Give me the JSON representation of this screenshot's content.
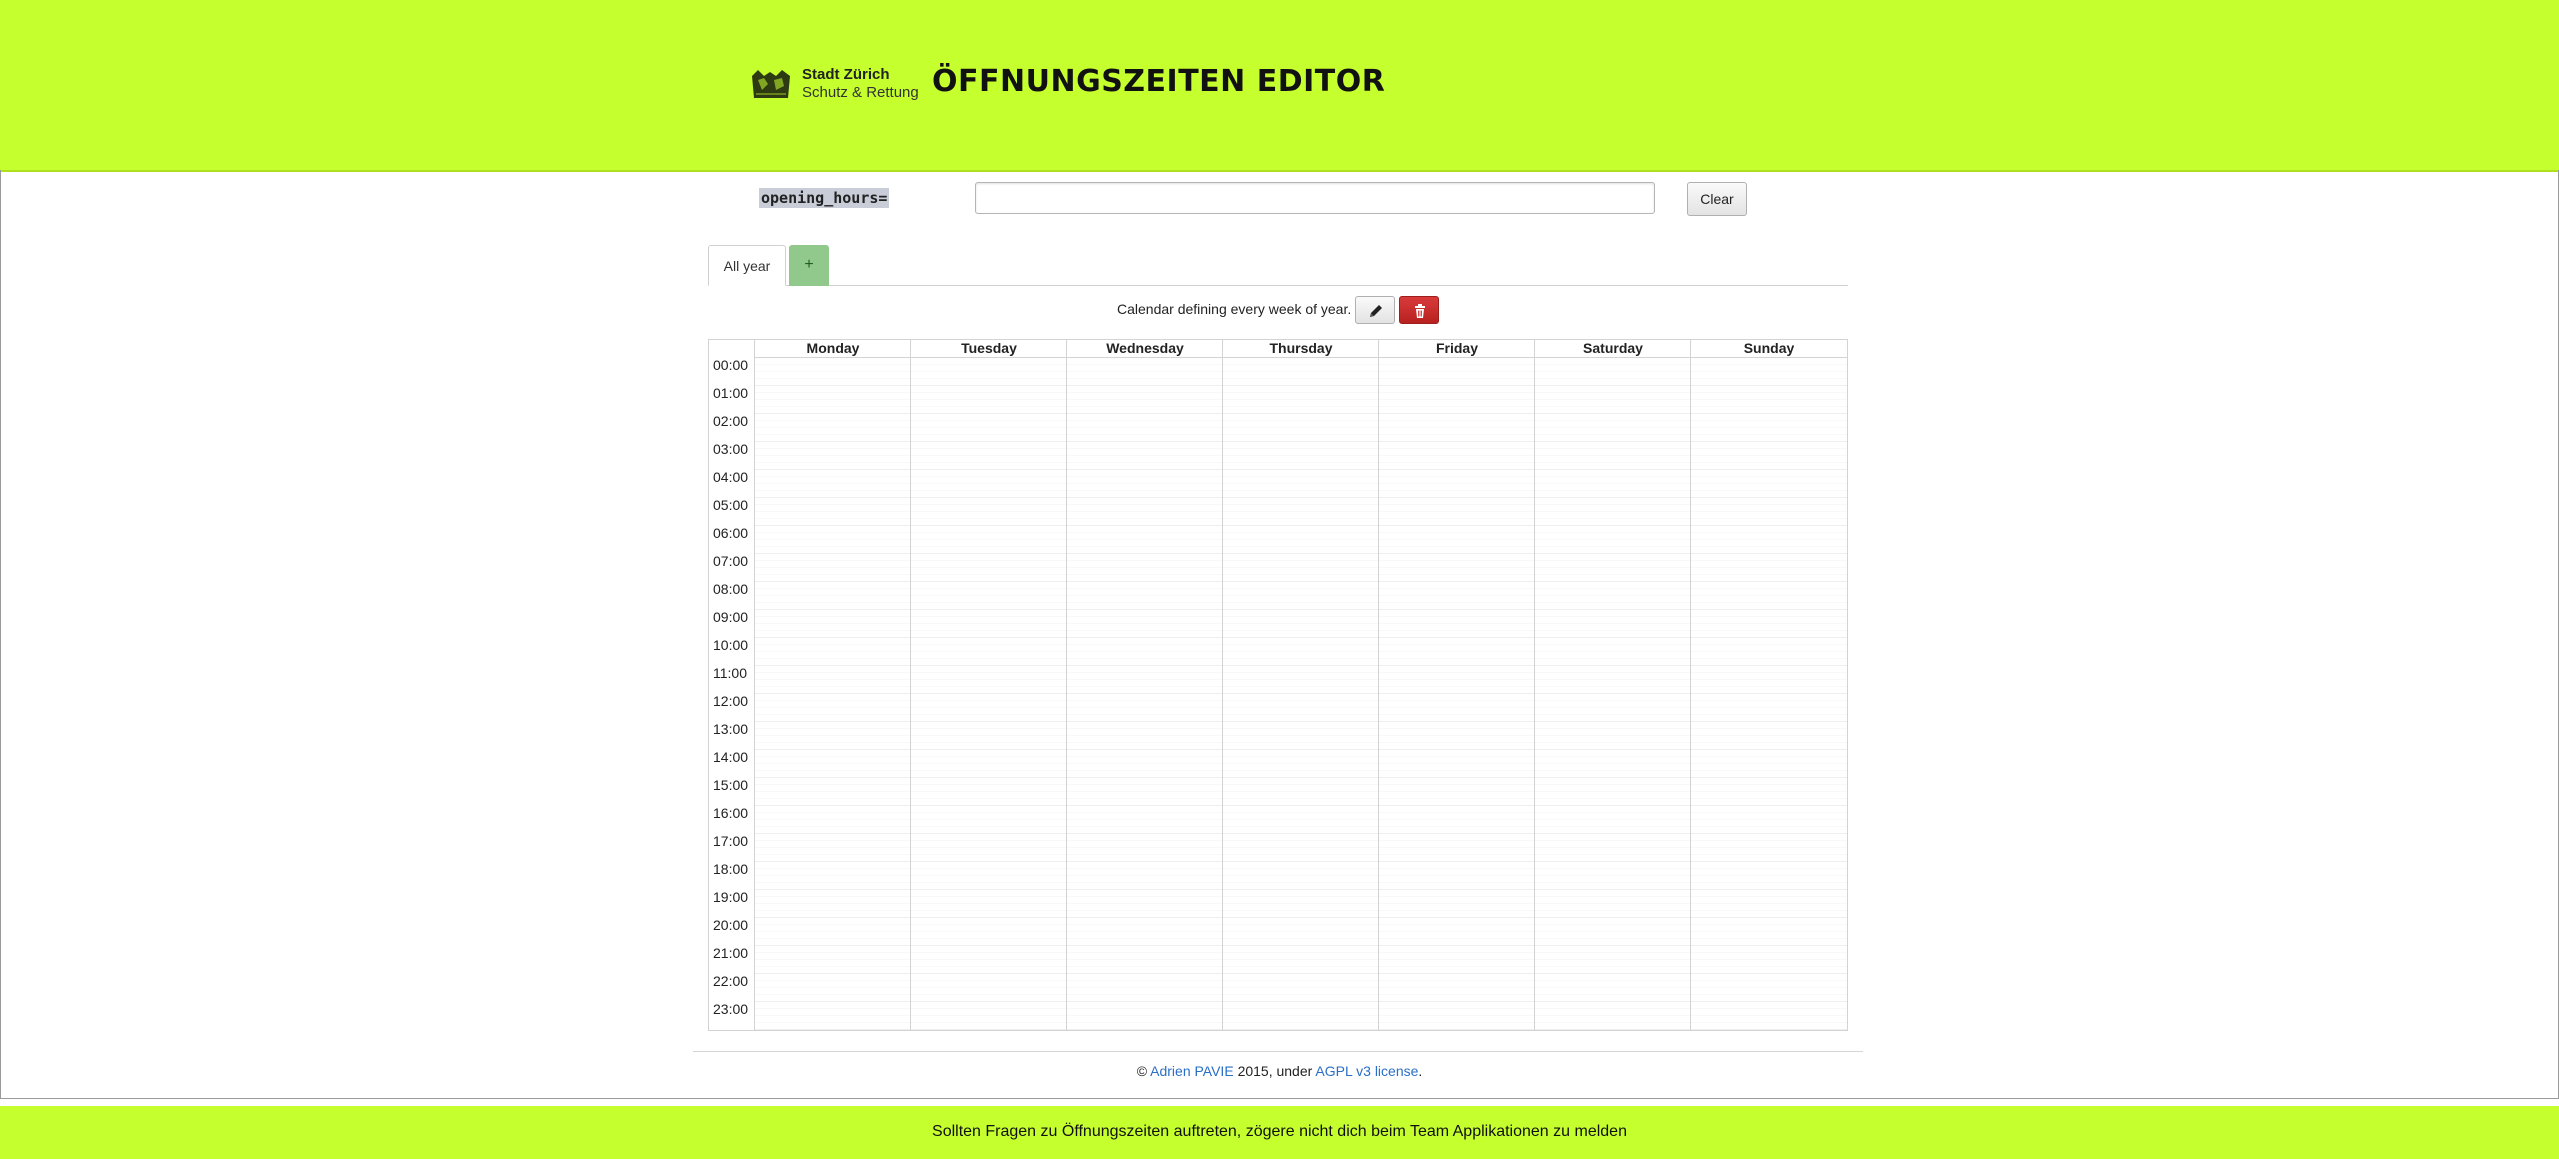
{
  "header": {
    "logo_line1": "Stadt Zürich",
    "logo_line2": "Schutz & Rettung",
    "title": "ÖFFNUNGSZEITEN EDITOR"
  },
  "editor": {
    "label": "opening_hours=",
    "input_value": "",
    "clear_label": "Clear"
  },
  "tabs": {
    "all_year": "All year",
    "add": "+"
  },
  "calendar": {
    "caption": "Calendar defining every week of year.",
    "days": [
      "Monday",
      "Tuesday",
      "Wednesday",
      "Thursday",
      "Friday",
      "Saturday",
      "Sunday"
    ],
    "hours": [
      "00:00",
      "01:00",
      "02:00",
      "03:00",
      "04:00",
      "05:00",
      "06:00",
      "07:00",
      "08:00",
      "09:00",
      "10:00",
      "11:00",
      "12:00",
      "13:00",
      "14:00",
      "15:00",
      "16:00",
      "17:00",
      "18:00",
      "19:00",
      "20:00",
      "21:00",
      "22:00",
      "23:00"
    ]
  },
  "footer": {
    "copyright": "©",
    "author": "Adrien PAVIE",
    "year_text": "2015, under",
    "license": "AGPL v3 license",
    "period": "."
  },
  "bottom_banner": {
    "text": "Sollten Fragen zu Öffnungszeiten auftreten, zögere nicht dich beim Team Applikationen zu melden"
  },
  "colors": {
    "brand_green": "#c6ff2e",
    "tab_green": "#90c98b",
    "delete_red": "#c62828",
    "link_blue": "#2a6ec6"
  },
  "icons": {
    "edit": "pencil-icon",
    "delete": "trash-icon",
    "logo": "zurich-lions-logo"
  }
}
